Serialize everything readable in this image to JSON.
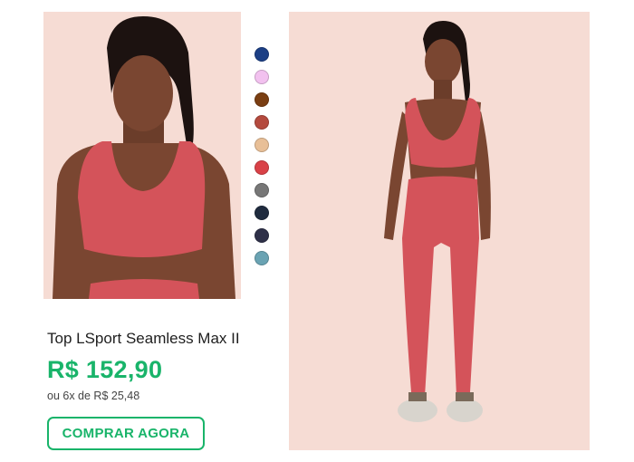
{
  "product": {
    "name": "Top LSport Seamless Max II",
    "price": "R$ 152,90",
    "installments": "ou 6x de R$ 25,48",
    "buy_label": "COMPRAR AGORA"
  },
  "images": {
    "left_alt": "Top LSport Seamless Max II - close-up",
    "right_alt": "Top LSport Seamless Max II - full body"
  },
  "colors": {
    "accent": "#19b46a",
    "product": "#d4535a",
    "background": "#f6dcd4"
  },
  "swatches": [
    {
      "color": "#1c3f85"
    },
    {
      "color": "#f2c1ef"
    },
    {
      "color": "#7a3e12"
    },
    {
      "color": "#b44a3e"
    },
    {
      "color": "#e8bf97"
    },
    {
      "color": "#d94147"
    },
    {
      "color": "#777777"
    },
    {
      "color": "#1f2b3e"
    },
    {
      "color": "#2e3048"
    },
    {
      "color": "#6aa3b3"
    }
  ]
}
